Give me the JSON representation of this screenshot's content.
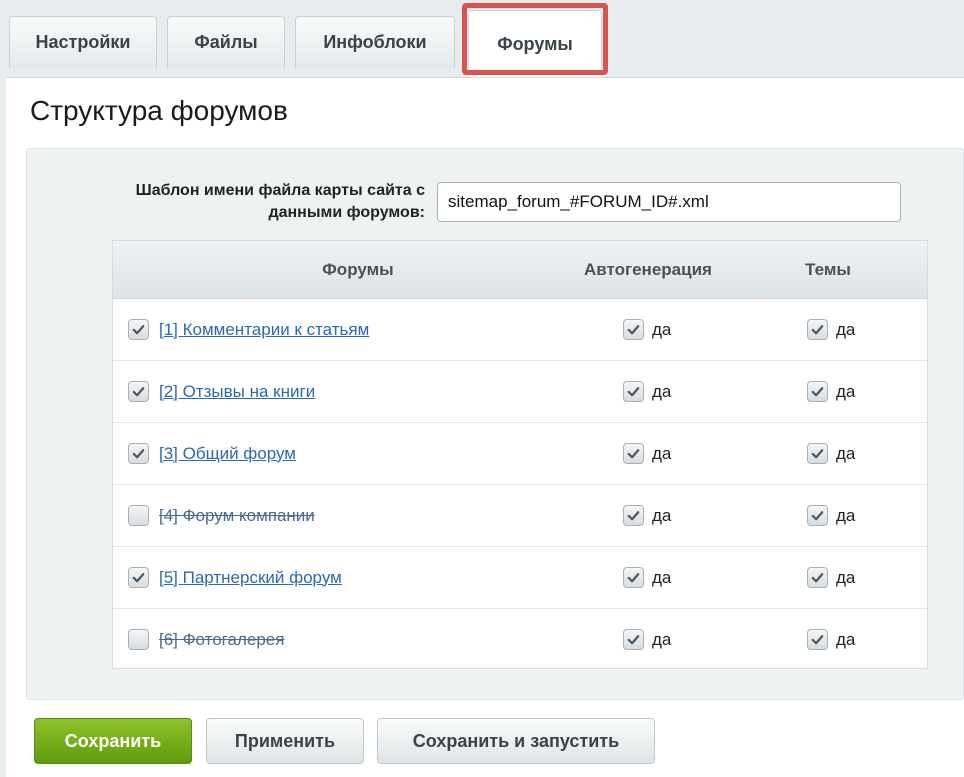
{
  "tabs": [
    {
      "label": "Настройки"
    },
    {
      "label": "Файлы"
    },
    {
      "label": "Инфоблоки"
    },
    {
      "label": "Форумы"
    }
  ],
  "page_title": "Структура форумов",
  "sitemap_field": {
    "label": "Шаблон имени файла карты сайта с данными форумов:",
    "value": "sitemap_forum_#FORUM_ID#.xml"
  },
  "table": {
    "headers": {
      "forums": "Форумы",
      "autogen": "Автогенерация",
      "topics": "Темы"
    },
    "rows": [
      {
        "name": "[1] Комментарии к статьям",
        "checked": true,
        "autogen": "да",
        "topics": "да"
      },
      {
        "name": "[2] Отзывы на книги",
        "checked": true,
        "autogen": "да",
        "topics": "да"
      },
      {
        "name": "[3] Общий форум",
        "checked": true,
        "autogen": "да",
        "topics": "да"
      },
      {
        "name": "[4] Форум компании",
        "checked": false,
        "autogen": "да",
        "topics": "да"
      },
      {
        "name": "[5] Партнерский форум",
        "checked": true,
        "autogen": "да",
        "topics": "да"
      },
      {
        "name": "[6] Фотогалерея",
        "checked": false,
        "autogen": "да",
        "topics": "да"
      }
    ]
  },
  "buttons": {
    "save": "Сохранить",
    "apply": "Применить",
    "save_and_run": "Сохранить и запустить"
  },
  "colors": {
    "accent_green": "#6aa715",
    "link": "#2b6ab3",
    "highlight": "#d9534f"
  }
}
